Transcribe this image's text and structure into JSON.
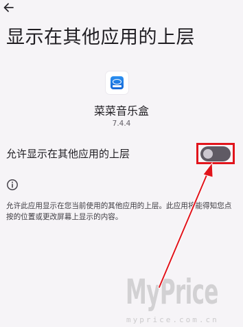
{
  "header": {
    "back_icon": "arrow-left-icon",
    "title": "显示在其他应用的上层"
  },
  "app": {
    "icon": "music-app-icon",
    "name": "菜菜音乐盒",
    "version": "7.4.4"
  },
  "setting": {
    "label": "允许显示在其他应用的上层",
    "toggle_state": "off",
    "highlight_color": "#e1141c"
  },
  "info": {
    "icon": "info-icon",
    "description": "允许此应用显示在您当前使用的其他应用的上层。此应用将能得知您点按的位置或更改屏幕上显示的内容。"
  },
  "watermark": {
    "text": "MyPrice",
    "subtext": "myprice.com.cn"
  },
  "colors": {
    "background": "#f6f4f7",
    "annotation_red": "#e1141c",
    "toggle_off_track": "#5f5a64"
  }
}
